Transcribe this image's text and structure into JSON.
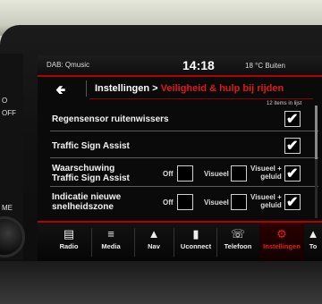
{
  "status": {
    "source": "DAB: Qmusic",
    "time": "14:18",
    "temperature": "18 °C Buiten"
  },
  "breadcrumb": {
    "parent": "Instellingen >",
    "current": "Veiligheid & hulp bij rijden"
  },
  "item_count": "12 items in lijst",
  "rows": [
    {
      "label": "Regensensor ruitenwissers",
      "checked": true
    },
    {
      "label": "Traffic Sign Assist",
      "checked": true
    },
    {
      "label_line1": "Waarschuwing",
      "label_line2": "Traffic Sign Assist",
      "options": {
        "off": "Off",
        "visual": "Visueel",
        "visual_sound_1": "Visueel +",
        "visual_sound_2": "geluid"
      },
      "selected": "visual_sound"
    },
    {
      "label_line1": "Indicatie nieuwe",
      "label_line2": "snelheidszone",
      "options": {
        "off": "Off",
        "visual": "Visueel",
        "visual_sound_1": "Visueel +",
        "visual_sound_2": "geluid"
      },
      "selected": "visual_sound"
    }
  ],
  "nav": [
    {
      "label": "Radio",
      "icon": "radio-icon"
    },
    {
      "label": "Media",
      "icon": "media-icon"
    },
    {
      "label": "Nav",
      "icon": "nav-icon"
    },
    {
      "label": "Uconnect",
      "icon": "uconnect-icon"
    },
    {
      "label": "Telefoon",
      "icon": "phone-icon"
    },
    {
      "label": "Instellingen",
      "icon": "settings-icon",
      "active": true
    },
    {
      "label": "To",
      "icon": "tools-icon"
    }
  ],
  "side_labels": {
    "a": "O",
    "b": "OFF",
    "c": "ME"
  },
  "colors": {
    "accent": "#e01818",
    "divider": "#b30000"
  }
}
